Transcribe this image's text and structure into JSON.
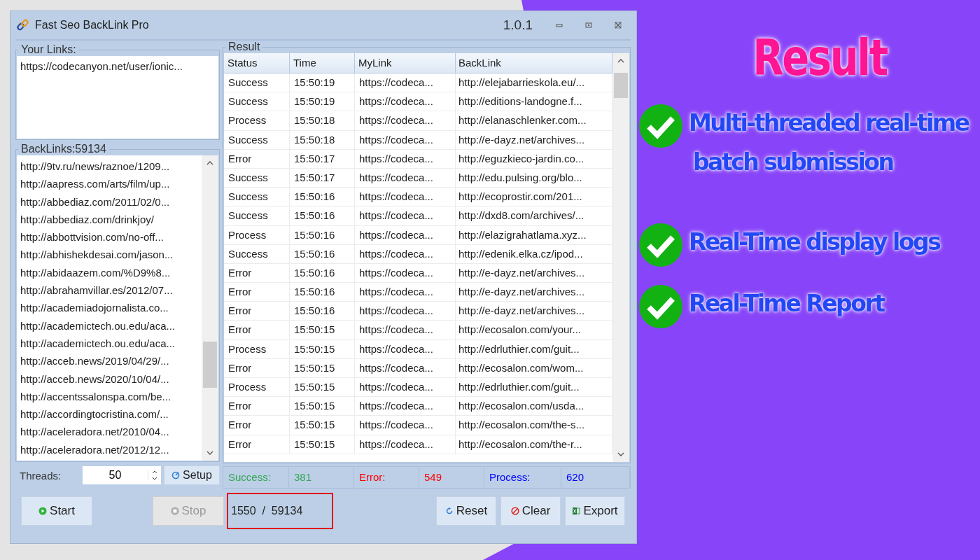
{
  "window": {
    "title": "Fast Seo BackLink Pro",
    "version": "1.0.1"
  },
  "your_links": {
    "label": "Your Links:",
    "lines": [
      "https://codecanyon.net/user/ionic..."
    ]
  },
  "backlinks": {
    "label": "BackLinks:59134",
    "items": [
      "http://9tv.ru/news/raznoe/1209...",
      "http://aapress.com/arts/film/up...",
      "http://abbediaz.com/2011/02/0...",
      "http://abbediaz.com/drinkjoy/",
      "http://abbottvision.com/no-off...",
      "http://abhishekdesai.com/jason...",
      "http://abidaazem.com/%D9%8...",
      "http://abrahamvillar.es/2012/07...",
      "http://academiadojornalista.co...",
      "http://academictech.ou.edu/aca...",
      "http://academictech.ou.edu/aca...",
      "http://acceb.news/2019/04/29/...",
      "http://acceb.news/2020/10/04/...",
      "http://accentssalonspa.com/be...",
      "http://accordingtocristina.com/...",
      "http://aceleradora.net/2010/04...",
      "http://aceleradora.net/2012/12..."
    ]
  },
  "result": {
    "label": "Result",
    "columns": [
      "Status",
      "Time",
      "MyLink",
      "BackLink"
    ],
    "rows": [
      [
        "Success",
        "15:50:19",
        "https://codeca...",
        "http://elejabarrieskola.eu/..."
      ],
      [
        "Success",
        "15:50:19",
        "https://codeca...",
        "http://editions-landogne.f..."
      ],
      [
        "Process",
        "15:50:18",
        "https://codeca...",
        "http://elanaschlenker.com..."
      ],
      [
        "Success",
        "15:50:18",
        "https://codeca...",
        "http://e-dayz.net/archives..."
      ],
      [
        "Error",
        "15:50:17",
        "https://codeca...",
        "http://eguzkieco-jardin.co..."
      ],
      [
        "Success",
        "15:50:17",
        "https://codeca...",
        "http://edu.pulsing.org/blo..."
      ],
      [
        "Success",
        "15:50:16",
        "https://codeca...",
        "http://ecoprostir.com/201..."
      ],
      [
        "Success",
        "15:50:16",
        "https://codeca...",
        "http://dxd8.com/archives/..."
      ],
      [
        "Process",
        "15:50:16",
        "https://codeca...",
        "http://elazigrahatlama.xyz..."
      ],
      [
        "Success",
        "15:50:16",
        "https://codeca...",
        "http://edenik.elka.cz/ipod..."
      ],
      [
        "Error",
        "15:50:16",
        "https://codeca...",
        "http://e-dayz.net/archives..."
      ],
      [
        "Error",
        "15:50:16",
        "https://codeca...",
        "http://e-dayz.net/archives..."
      ],
      [
        "Error",
        "15:50:16",
        "https://codeca...",
        "http://e-dayz.net/archives..."
      ],
      [
        "Error",
        "15:50:15",
        "https://codeca...",
        "http://ecosalon.com/your..."
      ],
      [
        "Process",
        "15:50:15",
        "https://codeca...",
        "http://edrluthier.com/guit..."
      ],
      [
        "Error",
        "15:50:15",
        "https://codeca...",
        "http://ecosalon.com/wom..."
      ],
      [
        "Process",
        "15:50:15",
        "https://codeca...",
        "http://edrluthier.com/guit..."
      ],
      [
        "Error",
        "15:50:15",
        "https://codeca...",
        "http://ecosalon.com/usda..."
      ],
      [
        "Error",
        "15:50:15",
        "https://codeca...",
        "http://ecosalon.com/the-s..."
      ],
      [
        "Error",
        "15:50:15",
        "https://codeca...",
        "http://ecosalon.com/the-r..."
      ]
    ]
  },
  "threads": {
    "label": "Threads:",
    "value": "50"
  },
  "stats": [
    {
      "label": "Success:",
      "value": "381",
      "color": "#33a852"
    },
    {
      "label": "Error:",
      "value": "549",
      "color": "#ff0000"
    },
    {
      "label": "Process:",
      "value": "620",
      "color": "#0000ff"
    }
  ],
  "buttons": [
    {
      "kind": "setup",
      "label": "Setup",
      "disabled": false
    },
    {
      "kind": "start",
      "label": "Start",
      "disabled": false
    },
    {
      "kind": "stop",
      "label": "Stop",
      "disabled": true
    },
    {
      "kind": "reset",
      "label": "Reset",
      "disabled": false
    },
    {
      "kind": "clear",
      "label": "Clear",
      "disabled": false
    },
    {
      "kind": "export",
      "label": "Export",
      "disabled": false
    }
  ],
  "progress": "1550  /  59134",
  "promo": {
    "title": "Result",
    "features": [
      [
        "Multi-threaded real-time",
        "batch submission"
      ],
      [
        "Real-Time display logs"
      ],
      [
        "Real-Time Report"
      ]
    ]
  }
}
